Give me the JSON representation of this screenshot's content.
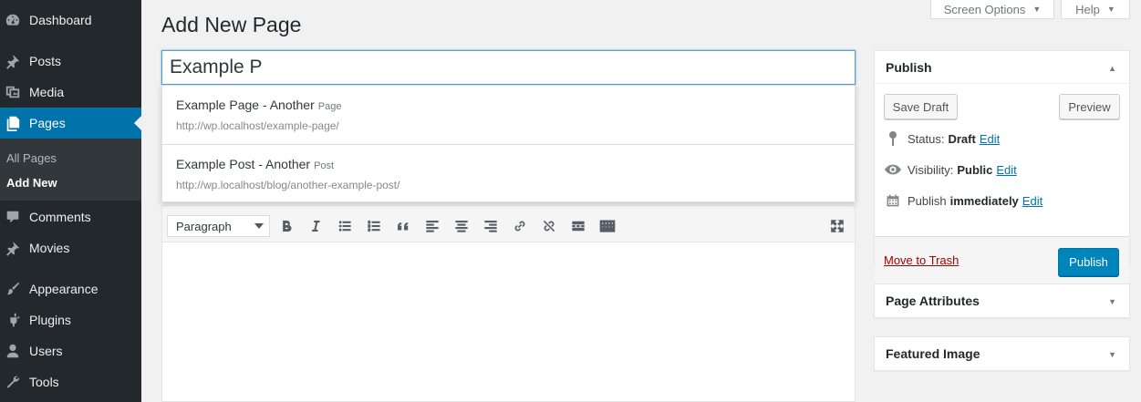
{
  "sidebar": {
    "items": [
      {
        "label": "Dashboard",
        "icon": "dashboard-icon"
      },
      {
        "label": "Posts",
        "icon": "pin-icon"
      },
      {
        "label": "Media",
        "icon": "media-icon"
      },
      {
        "label": "Pages",
        "icon": "pages-icon"
      },
      {
        "label": "Comments",
        "icon": "comment-icon"
      },
      {
        "label": "Movies",
        "icon": "pin-icon"
      },
      {
        "label": "Appearance",
        "icon": "brush-icon"
      },
      {
        "label": "Plugins",
        "icon": "plugin-icon"
      },
      {
        "label": "Users",
        "icon": "user-icon"
      },
      {
        "label": "Tools",
        "icon": "wrench-icon"
      }
    ],
    "submenu": [
      "All Pages",
      "Add New"
    ],
    "current": "Pages"
  },
  "screen_meta": {
    "screen_options": "Screen Options",
    "help": "Help"
  },
  "page_title": "Add New Page",
  "title_input": {
    "value": "Example P"
  },
  "autocomplete": [
    {
      "title": "Example Page - Another",
      "type": "Page",
      "url": "http://wp.localhost/example-page/"
    },
    {
      "title": "Example Post - Another",
      "type": "Post",
      "url": "http://wp.localhost/blog/another-example-post/"
    }
  ],
  "editor": {
    "format_select": "Paragraph"
  },
  "publish_box": {
    "title": "Publish",
    "save_draft": "Save Draft",
    "preview": "Preview",
    "status_label": "Status:",
    "status_value": "Draft",
    "visibility_label": "Visibility:",
    "visibility_value": "Public",
    "publish_label": "Publish",
    "publish_value": "immediately",
    "edit": "Edit",
    "move_to_trash": "Move to Trash",
    "publish_button": "Publish"
  },
  "page_attributes": {
    "title": "Page Attributes"
  },
  "featured_image": {
    "title": "Featured Image"
  },
  "colors": {
    "sidebar": "#23282d",
    "accent": "#0073aa",
    "publish_button": "#0085ba",
    "trash": "#a00"
  }
}
